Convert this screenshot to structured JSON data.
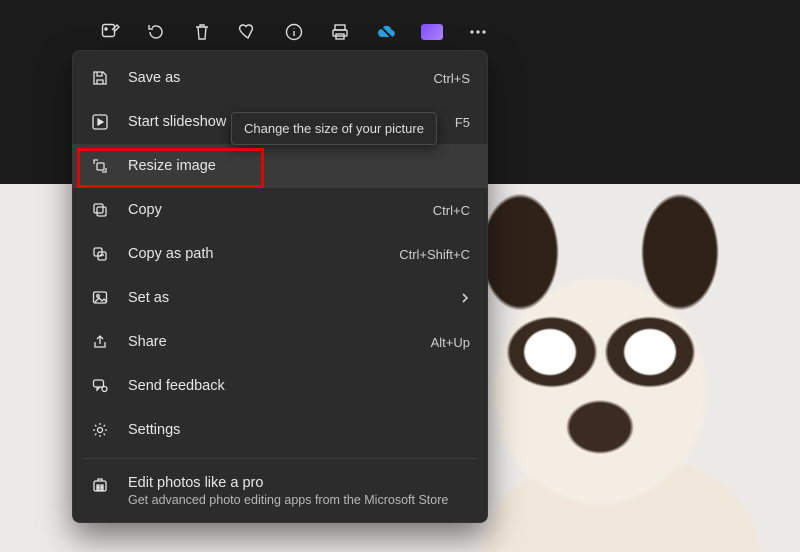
{
  "toolbar": {
    "items": [
      "edit",
      "rotate",
      "delete",
      "favorite",
      "info",
      "print",
      "cloud",
      "clipchamp",
      "more"
    ]
  },
  "tooltip": {
    "text": "Change the size of your picture"
  },
  "menu": {
    "items": [
      {
        "id": "save-as",
        "label": "Save as",
        "shortcut": "Ctrl+S"
      },
      {
        "id": "slideshow",
        "label": "Start slideshow",
        "shortcut": "F5"
      },
      {
        "id": "resize",
        "label": "Resize image",
        "shortcut": ""
      },
      {
        "id": "copy",
        "label": "Copy",
        "shortcut": "Ctrl+C"
      },
      {
        "id": "copy-path",
        "label": "Copy as path",
        "shortcut": "Ctrl+Shift+C"
      },
      {
        "id": "set-as",
        "label": "Set as",
        "shortcut": "",
        "submenu": true
      },
      {
        "id": "share",
        "label": "Share",
        "shortcut": "Alt+Up"
      },
      {
        "id": "feedback",
        "label": "Send feedback",
        "shortcut": ""
      },
      {
        "id": "settings",
        "label": "Settings",
        "shortcut": ""
      }
    ],
    "promo": {
      "title": "Edit photos like a pro",
      "subtitle": "Get advanced photo editing apps from the Microsoft Store"
    }
  },
  "highlight": "resize"
}
